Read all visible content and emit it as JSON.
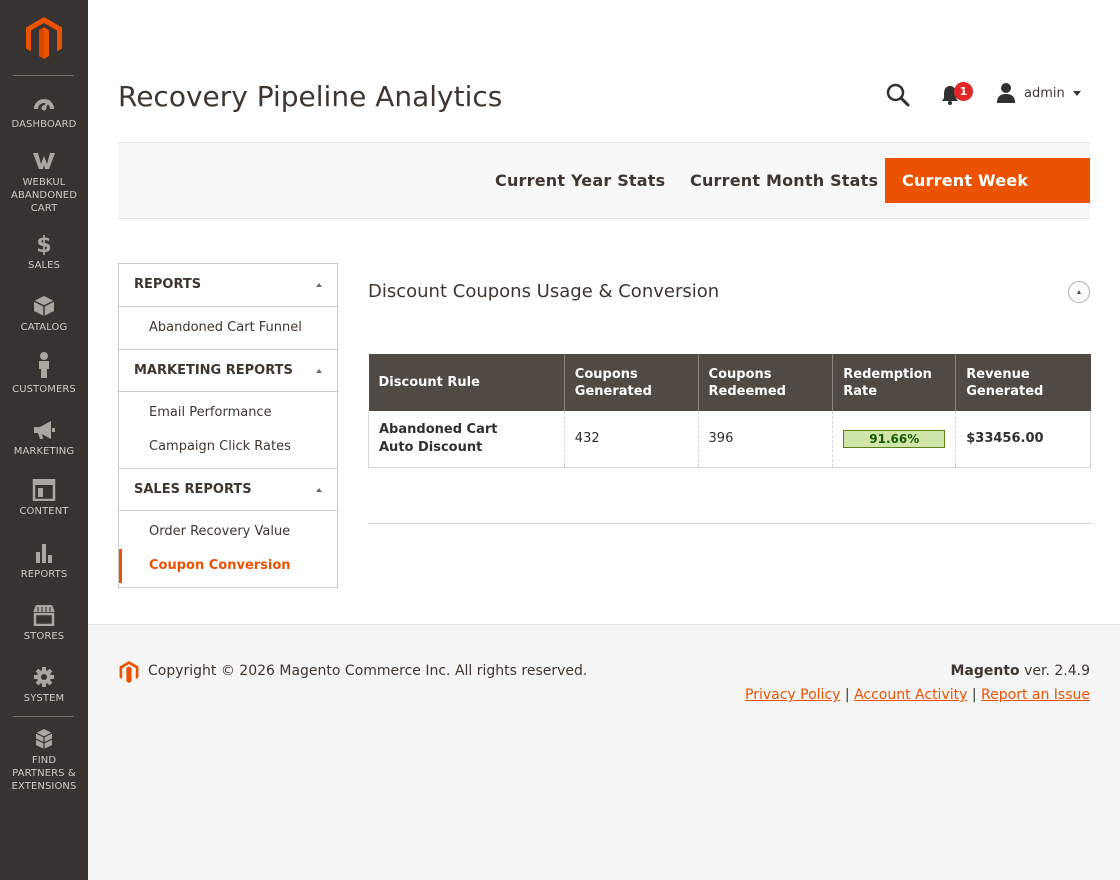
{
  "page": {
    "title": "Recovery Pipeline Analytics"
  },
  "sidebar": {
    "logo": "magento-logo",
    "items": [
      {
        "label": "DASHBOARD",
        "icon": "dashboard-icon"
      },
      {
        "label": "WEBKUL ABANDONED CART",
        "icon": "webkul-icon"
      },
      {
        "label": "SALES",
        "icon": "dollar-icon"
      },
      {
        "label": "CATALOG",
        "icon": "box-icon"
      },
      {
        "label": "CUSTOMERS",
        "icon": "person-icon"
      },
      {
        "label": "MARKETING",
        "icon": "megaphone-icon"
      },
      {
        "label": "CONTENT",
        "icon": "layout-icon"
      },
      {
        "label": "REPORTS",
        "icon": "bar-chart-icon"
      },
      {
        "label": "STORES",
        "icon": "store-icon"
      },
      {
        "label": "SYSTEM",
        "icon": "gear-icon"
      },
      {
        "label": "FIND PARTNERS & EXTENSIONS",
        "icon": "cubes-icon"
      }
    ]
  },
  "header": {
    "notifications_count": "1",
    "user_name": "admin"
  },
  "tabs": [
    {
      "label": "Current Year Stats",
      "active": false
    },
    {
      "label": "Current Month Stats",
      "active": false
    },
    {
      "label": "Current Week Stats",
      "active": true
    }
  ],
  "left_menu": {
    "sections": [
      {
        "title": "REPORTS",
        "items": [
          {
            "label": "Abandoned Cart Funnel",
            "active": false
          }
        ]
      },
      {
        "title": "MARKETING REPORTS",
        "items": [
          {
            "label": "Email Performance",
            "active": false
          },
          {
            "label": "Campaign Click Rates",
            "active": false
          }
        ]
      },
      {
        "title": "SALES REPORTS",
        "items": [
          {
            "label": "Order Recovery Value",
            "active": false
          },
          {
            "label": "Coupon Conversion",
            "active": true
          }
        ]
      }
    ]
  },
  "section": {
    "title": "Discount Coupons Usage & Conversion",
    "table": {
      "headers": [
        "Discount Rule",
        "Coupons Generated",
        "Coupons Redeemed",
        "Redemption Rate",
        "Revenue Generated"
      ],
      "rows": [
        {
          "rule": "Abandoned Cart Auto Discount",
          "generated": "432",
          "redeemed": "396",
          "rate": "91.66%",
          "revenue": "$33456.00"
        }
      ]
    }
  },
  "footer": {
    "copyright": "Copyright © 2026 Magento Commerce Inc. All rights reserved.",
    "brand": "Magento",
    "version": " ver. 2.4.9",
    "links": [
      "Privacy Policy",
      "Account Activity",
      "Report an Issue"
    ]
  },
  "colors": {
    "accent": "#eb5202",
    "sidebar_bg": "#373330",
    "table_header": "#514943",
    "rate_bar": "#d0e5a9"
  }
}
